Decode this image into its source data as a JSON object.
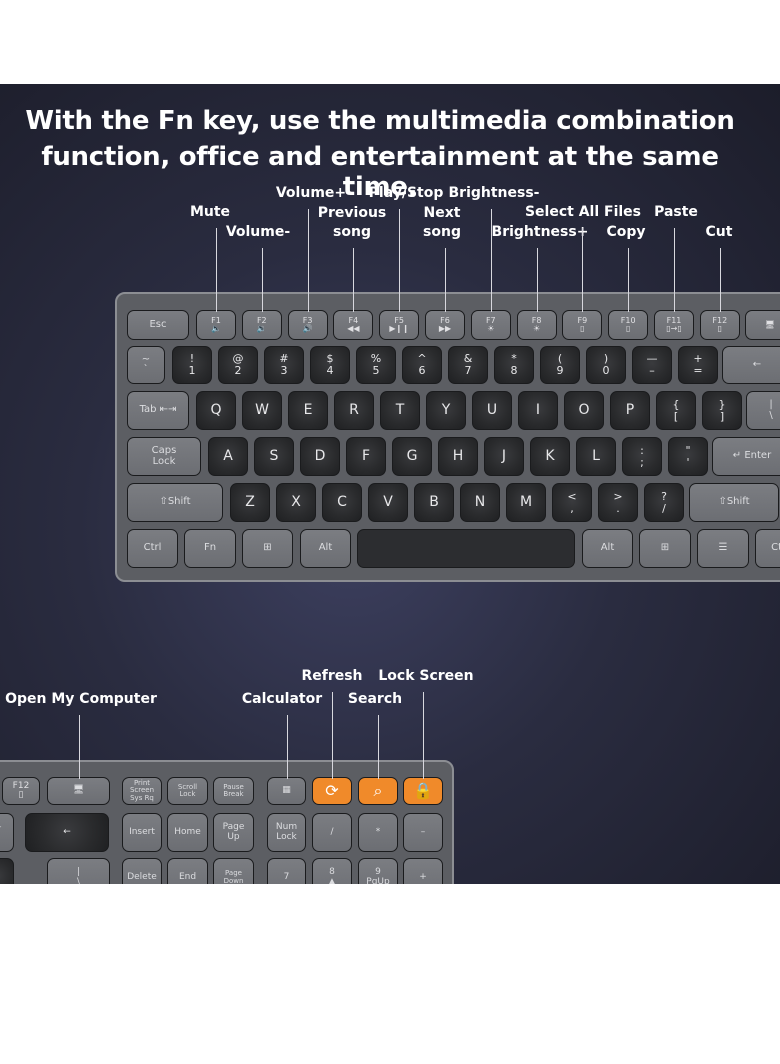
{
  "headline": [
    "With the Fn key, use the multimedia combination",
    "function, office and entertainment at the same time."
  ],
  "top_callouts": [
    {
      "text": "Mute",
      "key": "F1"
    },
    {
      "text": "Volume-",
      "key": "F2"
    },
    {
      "text": "Volume+",
      "key": "F3"
    },
    {
      "text": "Previous\nsong",
      "key": "F4"
    },
    {
      "text": "Play/Stop",
      "key": "F5"
    },
    {
      "text": "Next\nsong",
      "key": "F6"
    },
    {
      "text": "Brightness-",
      "key": "F7"
    },
    {
      "text": "Brightness+",
      "key": "F8"
    },
    {
      "text": "Select All Files",
      "key": "F9"
    },
    {
      "text": "Copy",
      "key": "F10"
    },
    {
      "text": "Paste",
      "key": "F11"
    },
    {
      "text": "Cut",
      "key": "F12"
    }
  ],
  "bottom_callouts": [
    {
      "text": "Open My Computer",
      "key": "My Computer"
    },
    {
      "text": "Calculator",
      "key": "Calculator"
    },
    {
      "text": "Refresh",
      "key": "Refresh"
    },
    {
      "text": "Search",
      "key": "Search"
    },
    {
      "text": "Lock Screen",
      "key": "Lock Screen"
    }
  ],
  "main_keyboard": {
    "rows": [
      [
        "Esc",
        "F1\n🔈",
        "F2\n🔉",
        "F3\n🔊",
        "F4\n◀◀",
        "F5\n▶❙❙",
        "F6\n▶▶",
        "F7\n☀",
        "F8\n☀",
        "F9\n▯",
        "F10\n▯",
        "F11\n▯→▯",
        "F12\n▯",
        "🖥"
      ],
      [
        "~\n`",
        "!\n1",
        "@\n2",
        "#\n3",
        "$\n4",
        "%\n5",
        "^\n6",
        "&\n7",
        "*\n8",
        "(\n9",
        ")\n0",
        "—\n–",
        "+\n=",
        "←"
      ],
      [
        "Tab ⇤⇥",
        "Q",
        "W",
        "E",
        "R",
        "T",
        "Y",
        "U",
        "I",
        "O",
        "P",
        "{\n[",
        "}\n]",
        "|\n\\"
      ],
      [
        "Caps\nLock",
        "A",
        "S",
        "D",
        "F",
        "G",
        "H",
        "J",
        "K",
        "L",
        ":\n;",
        "\"\n'",
        "↵ Enter"
      ],
      [
        "⇧Shift",
        "Z",
        "X",
        "C",
        "V",
        "B",
        "N",
        "M",
        "<\n,",
        ">\n.",
        "?\n/",
        "⇧Shift"
      ],
      [
        "Ctrl",
        "Fn",
        "⊞",
        "Alt",
        "",
        "Alt",
        "⊞",
        "☰",
        "Ctrl"
      ]
    ]
  },
  "side_keyboard": {
    "rows": [
      [
        "F12\n▯",
        "🖥",
        "Print\nScreen\nSys Rq",
        "Scroll\nLock",
        "Pause\nBreak",
        "▦",
        "⟳",
        "⌕",
        "🔒"
      ],
      [
        "—\n=",
        "←",
        "Insert",
        "Home",
        "Page\nUp",
        "Num\nLock",
        "/",
        "*",
        "–"
      ],
      [
        "}\n]",
        "|\n\\",
        "Delete",
        "End",
        "Page\nDown",
        "7",
        "8\n▲",
        "9\nPgUp",
        "+"
      ]
    ]
  },
  "colors": {
    "accent": "#f08a2a",
    "background": "#2a2c40",
    "keyboard_body": "#5c5e63"
  }
}
